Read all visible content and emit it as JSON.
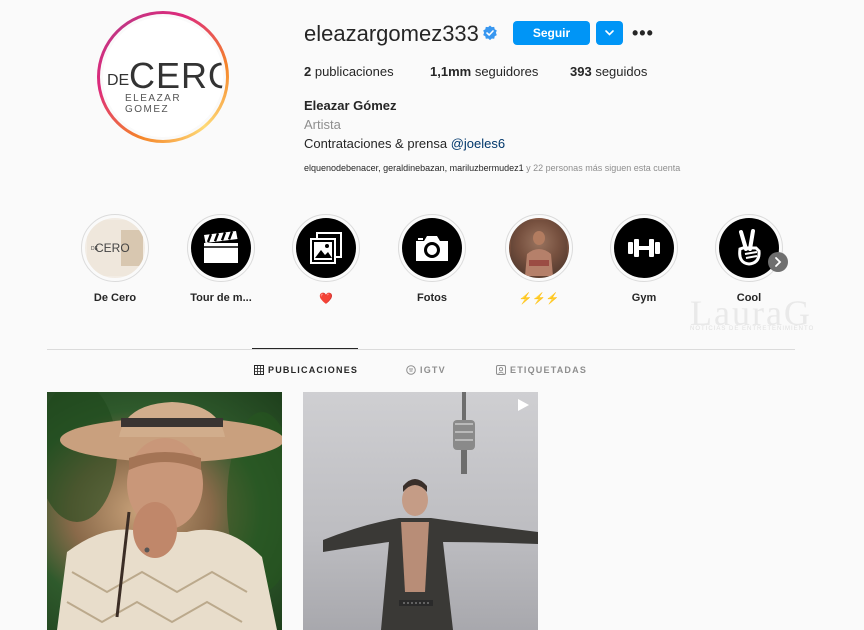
{
  "profile": {
    "username": "eleazargomez333",
    "follow_label": "Seguir",
    "more_label": "•••",
    "logo": {
      "top": "CERO",
      "prefix": "DE",
      "sub": "ELEAZAR GOMEZ"
    },
    "stats": {
      "posts_count": "2",
      "posts_label": " publicaciones",
      "followers_count": "1,1mm",
      "followers_label": " seguidores",
      "following_count": "393",
      "following_label": " seguidos"
    },
    "name": "Eleazar Gómez",
    "category": "Artista",
    "bio_text": "Contrataciones & prensa ",
    "bio_mention": "@joeles6",
    "followed_by": {
      "names": "elquenodebenacer, geraldinebazan, mariluzbermudez1",
      "suffix": " y 22 personas más siguen esta cuenta"
    }
  },
  "highlights": [
    {
      "label": "De Cero"
    },
    {
      "label": "Tour de m..."
    },
    {
      "label": "❤️"
    },
    {
      "label": "Fotos"
    },
    {
      "label": "⚡⚡⚡"
    },
    {
      "label": "Gym"
    },
    {
      "label": "Cool"
    }
  ],
  "watermark": {
    "text": "LauraG",
    "sub": "NOTICIAS DE ENTRETENIMIENTO"
  },
  "tabs": [
    {
      "label": "PUBLICACIONES",
      "icon": "grid-icon",
      "active": true
    },
    {
      "label": "IGTV",
      "icon": "igtv-icon",
      "active": false
    },
    {
      "label": "ETIQUETADAS",
      "icon": "tagged-icon",
      "active": false
    }
  ],
  "colors": {
    "accent": "#0095f6",
    "text": "#262626",
    "muted": "#8e8e8e",
    "background": "#fafafa"
  }
}
